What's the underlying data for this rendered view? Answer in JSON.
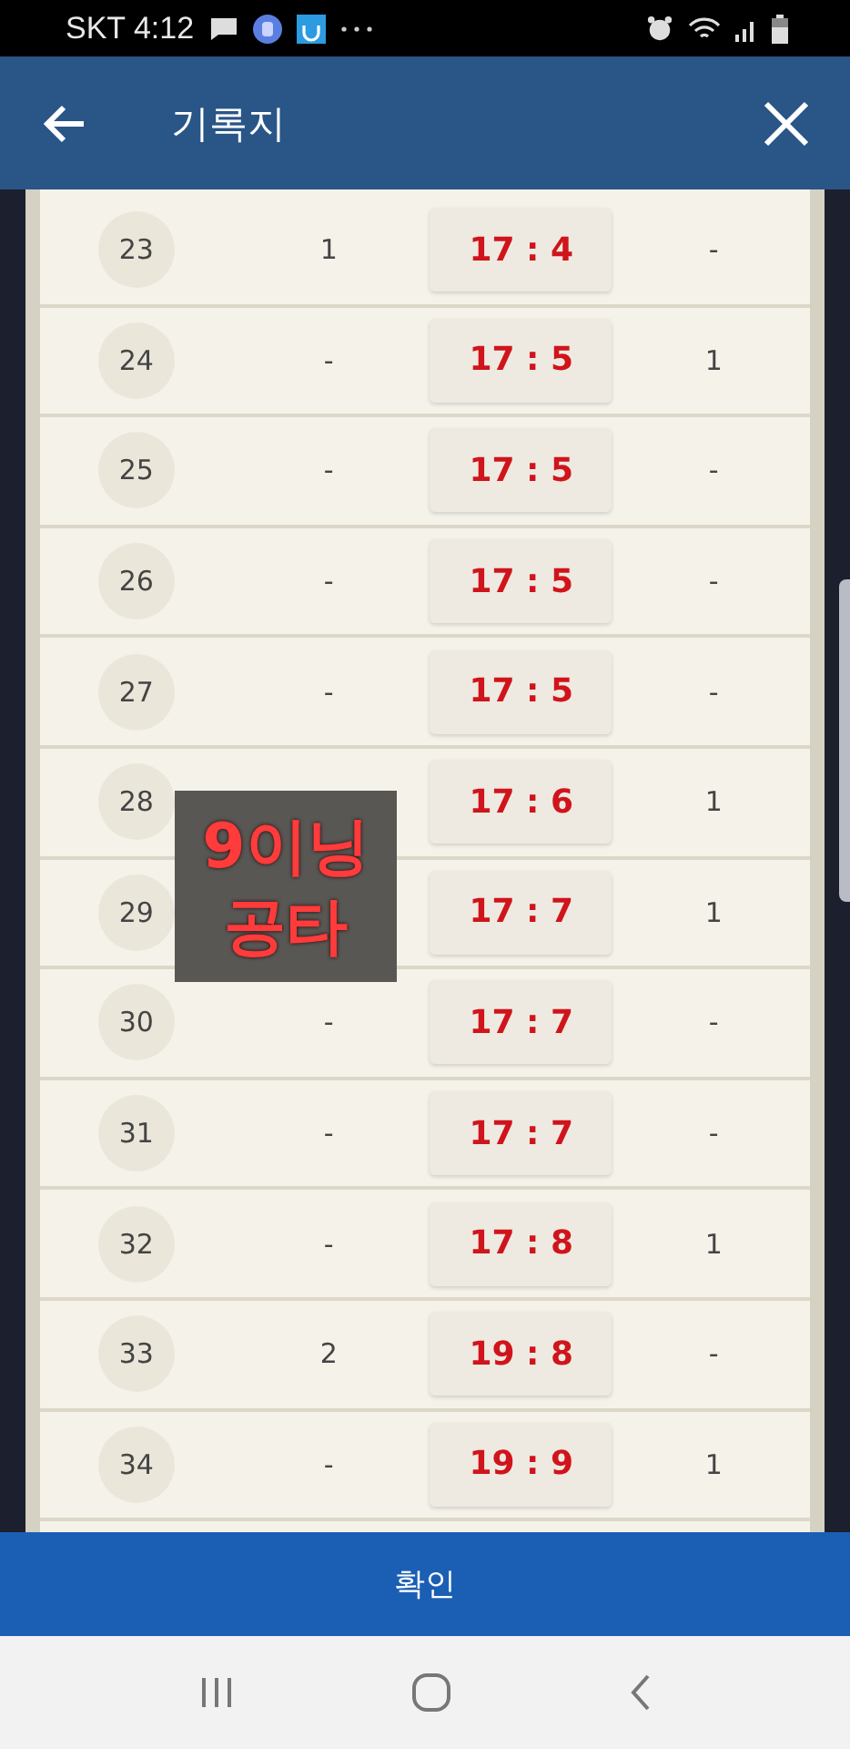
{
  "status_bar": {
    "carrier_time": "SKT 4:12"
  },
  "header": {
    "title": "기록지"
  },
  "rows": [
    {
      "number": "23",
      "column_2": "1",
      "score": "17 : 4",
      "column_4": "-"
    },
    {
      "number": "24",
      "column_2": "-",
      "score": "17 : 5",
      "column_4": "1"
    },
    {
      "number": "25",
      "column_2": "-",
      "score": "17 : 5",
      "column_4": "-"
    },
    {
      "number": "26",
      "column_2": "-",
      "score": "17 : 5",
      "column_4": "-"
    },
    {
      "number": "27",
      "column_2": "-",
      "score": "17 : 5",
      "column_4": "-"
    },
    {
      "number": "28",
      "score": "17 : 6",
      "column_4": "1"
    },
    {
      "number": "29",
      "score": "17 : 7",
      "column_4": "1"
    },
    {
      "number": "30",
      "column_2": "-",
      "score": "17 : 7",
      "column_4": "-"
    },
    {
      "number": "31",
      "column_2": "-",
      "score": "17 : 7",
      "column_4": "-"
    },
    {
      "number": "32",
      "column_2": "-",
      "score": "17 : 8",
      "column_4": "1"
    },
    {
      "number": "33",
      "column_2": "2",
      "score": "19 : 8",
      "column_4": "-"
    },
    {
      "number": "34",
      "column_2": "-",
      "score": "19 : 9",
      "column_4": "1"
    }
  ],
  "annotation": {
    "lines": [
      "9이닝",
      "공타"
    ]
  },
  "confirm_button": "확인"
}
